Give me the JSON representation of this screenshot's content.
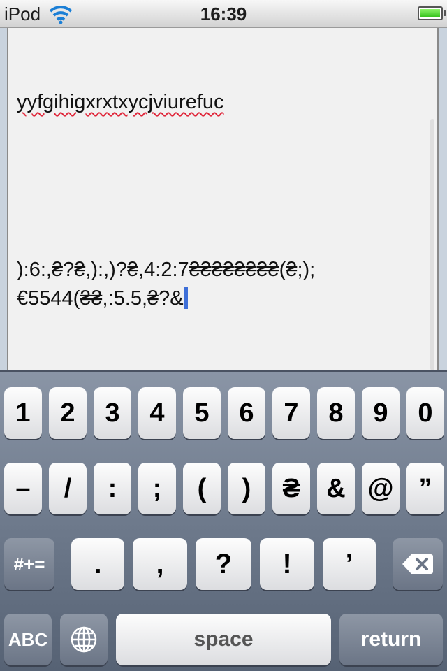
{
  "status_bar": {
    "carrier": "iPod",
    "time": "16:39",
    "wifi_icon": "wifi-icon",
    "battery_icon": "battery-icon",
    "battery_level": 1.0
  },
  "editor": {
    "lines": [
      "yyfgihigxrxtxycjviurefuc",
      "):6:,₴?₴,):,)?₴,4:2:7₴₴₴₴₴₴₴₴(₴;);",
      "€5544(₴₴,:5.5,₴?&"
    ]
  },
  "keyboard": {
    "row1": [
      "1",
      "2",
      "3",
      "4",
      "5",
      "6",
      "7",
      "8",
      "9",
      "0"
    ],
    "row2": [
      "–",
      "/",
      ":",
      ";",
      "(",
      ")",
      "₴",
      "&",
      "@",
      "”"
    ],
    "row3": [
      ".",
      ",",
      "?",
      "!",
      "’"
    ],
    "more_symbols": "#+=",
    "abc": "ABC",
    "space": "space",
    "return": "return",
    "globe_icon": "globe-icon",
    "delete_icon": "delete-icon"
  }
}
